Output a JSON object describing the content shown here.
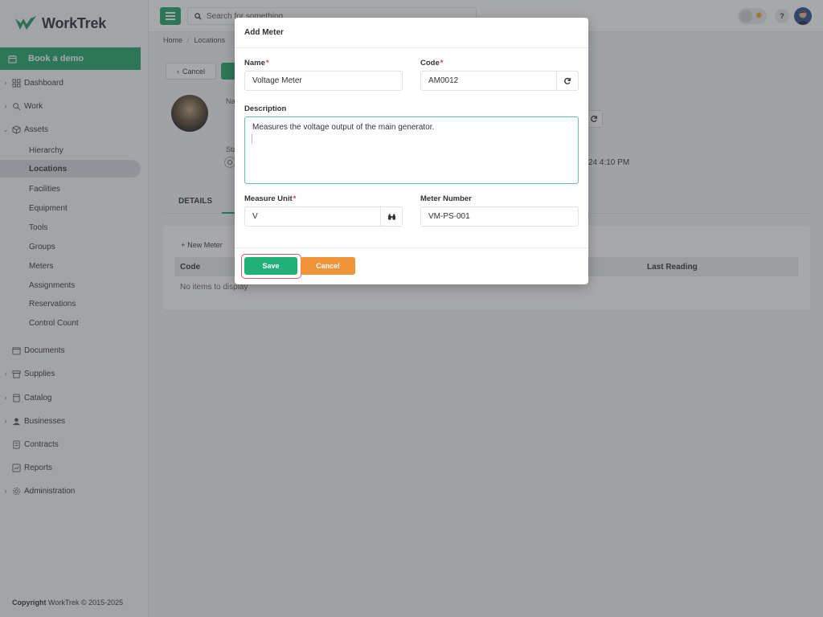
{
  "app": {
    "name": "WorkTrek"
  },
  "sidebar": {
    "book_demo": "Book a demo",
    "items": [
      {
        "label": "Dashboard",
        "icon": "dashboard-icon"
      },
      {
        "label": "Work",
        "icon": "work-icon"
      },
      {
        "label": "Assets",
        "icon": "assets-icon"
      },
      {
        "label": "Documents",
        "icon": "documents-icon"
      },
      {
        "label": "Supplies",
        "icon": "supplies-icon"
      },
      {
        "label": "Catalog",
        "icon": "catalog-icon"
      },
      {
        "label": "Businesses",
        "icon": "businesses-icon"
      },
      {
        "label": "Contracts",
        "icon": "contracts-icon"
      },
      {
        "label": "Reports",
        "icon": "reports-icon"
      },
      {
        "label": "Administration",
        "icon": "administration-icon"
      }
    ],
    "asset_subitems": [
      "Hierarchy",
      "Locations",
      "Facilities",
      "Equipment",
      "Tools",
      "Groups",
      "Meters",
      "Assignments",
      "Reservations",
      "Control Count"
    ],
    "active_subitem": "Locations",
    "copyright_bold": "Copyright",
    "copyright_rest": "WorkTrek © 2015-2025"
  },
  "topbar": {
    "search_placeholder": "Search for something..."
  },
  "breadcrumb": [
    "Home",
    "Locations"
  ],
  "page": {
    "cancel_label": "Cancel",
    "name_label_partial": "Na",
    "status_label_partial": "Sta",
    "status_badge": "O",
    "date_partial": "24 4:10 PM",
    "tab_details": "DETAILS",
    "new_meter": "New Meter",
    "table": {
      "col_code": "Code",
      "col_last_reading": "Last Reading",
      "empty": "No items to display"
    }
  },
  "modal": {
    "title": "Add Meter",
    "name_label": "Name",
    "name_value": "Voltage Meter",
    "code_label": "Code",
    "code_value": "AM0012",
    "description_label": "Description",
    "description_value": "Measures the voltage output of the main generator.",
    "measure_unit_label": "Measure Unit",
    "measure_unit_value": "V",
    "meter_number_label": "Meter Number",
    "meter_number_value": "VM-PS-001",
    "required_mark": "*",
    "save_label": "Save",
    "cancel_label": "Cancel"
  },
  "colors": {
    "brand": "#22a56b",
    "save": "#22b07a",
    "cancel": "#f0943a",
    "required": "#e03c3c",
    "focus_ring": "#e0566b"
  }
}
